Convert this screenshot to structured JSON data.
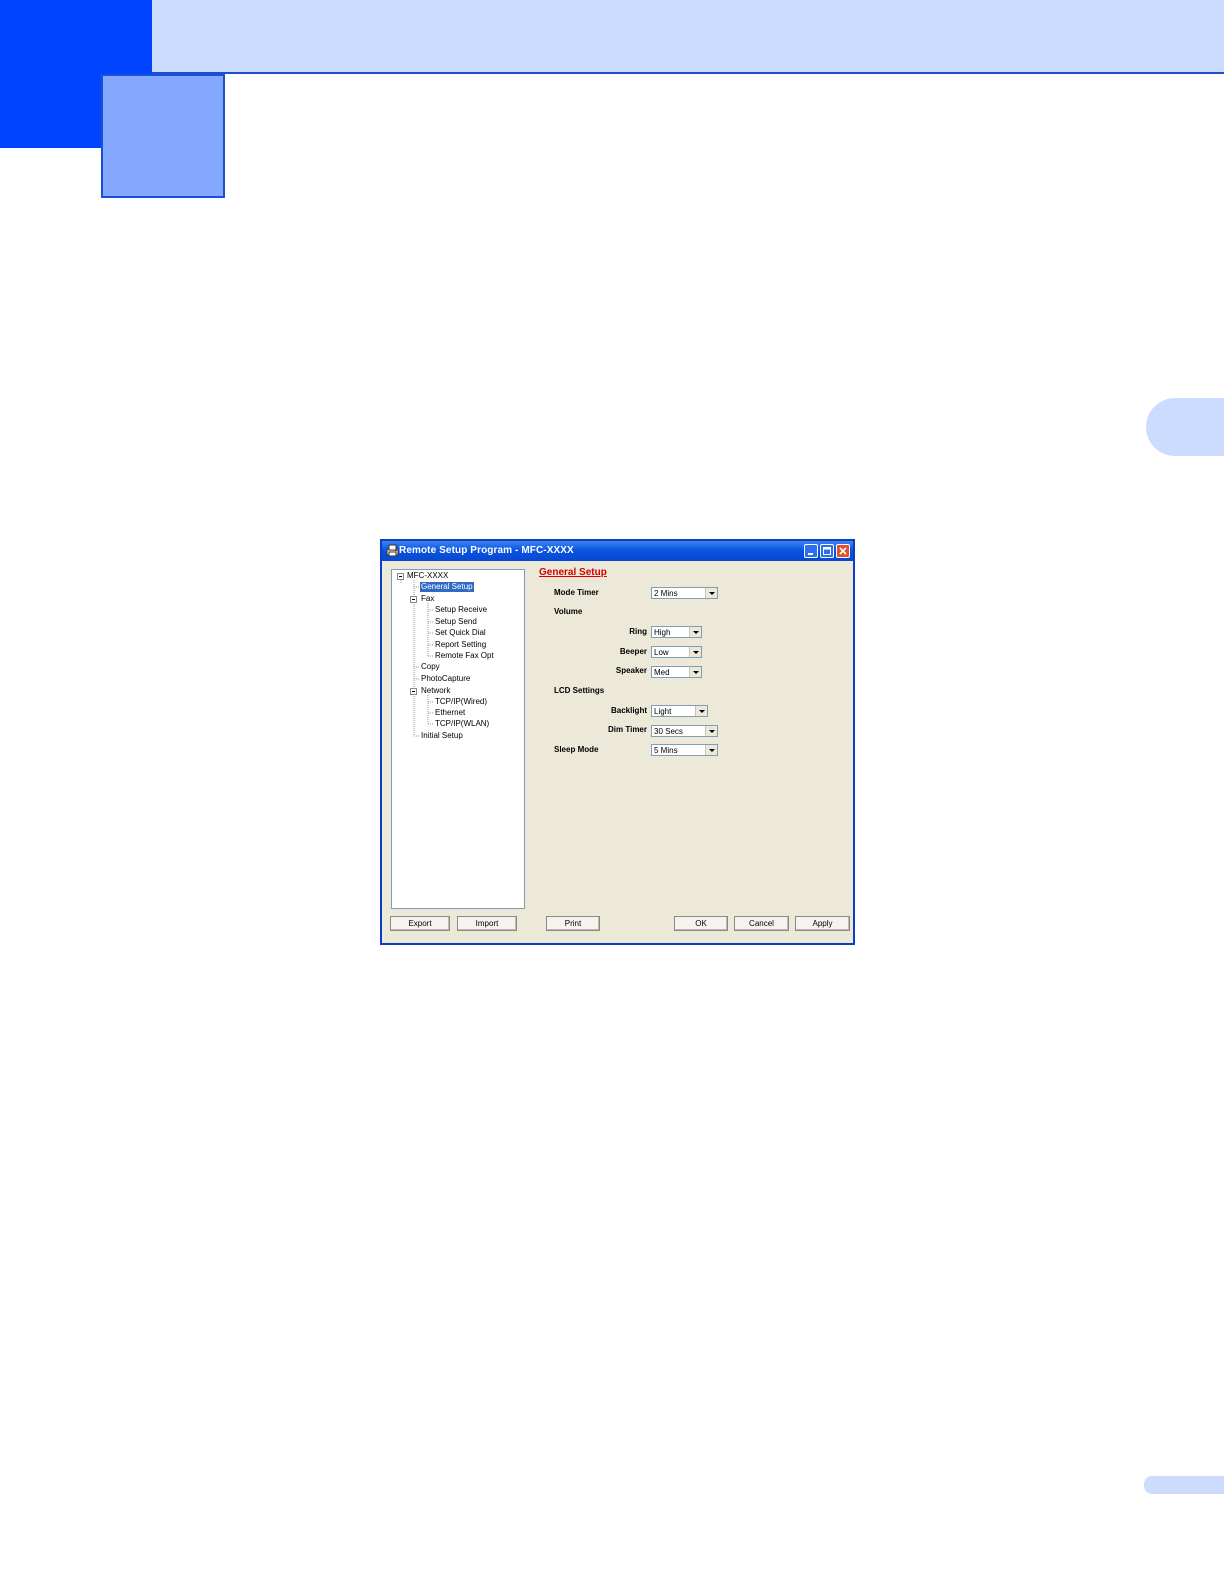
{
  "window": {
    "title": "Remote Setup Program - MFC-XXXX",
    "icons": {
      "app": "printer-app-icon",
      "minimize": "minimize-icon",
      "maximize": "maximize-icon",
      "close": "close-icon"
    }
  },
  "tree": {
    "items": [
      {
        "label": "MFC-XXXX"
      },
      {
        "label": "General Setup",
        "selected": true
      },
      {
        "label": "Fax"
      },
      {
        "label": "Setup Receive"
      },
      {
        "label": "Setup Send"
      },
      {
        "label": "Set Quick Dial"
      },
      {
        "label": "Report Setting"
      },
      {
        "label": "Remote Fax Opt"
      },
      {
        "label": "Copy"
      },
      {
        "label": "PhotoCapture"
      },
      {
        "label": "Network"
      },
      {
        "label": "TCP/IP(Wired)"
      },
      {
        "label": "Ethernet"
      },
      {
        "label": "TCP/IP(WLAN)"
      },
      {
        "label": "Initial Setup"
      }
    ]
  },
  "panel": {
    "title": "General Setup",
    "mode_timer": {
      "label": "Mode Timer",
      "value": "2 Mins"
    },
    "volume": {
      "heading": "Volume",
      "ring": {
        "label": "Ring",
        "value": "High"
      },
      "beeper": {
        "label": "Beeper",
        "value": "Low"
      },
      "speaker": {
        "label": "Speaker",
        "value": "Med"
      }
    },
    "lcd": {
      "heading": "LCD Settings",
      "backlight": {
        "label": "Backlight",
        "value": "Light"
      },
      "dim_timer": {
        "label": "Dim Timer",
        "value": "30 Secs"
      }
    },
    "sleep_mode": {
      "label": "Sleep Mode",
      "value": "5 Mins"
    }
  },
  "buttons": {
    "export": "Export",
    "import": "Import",
    "print": "Print",
    "ok": "OK",
    "cancel": "Cancel",
    "apply": "Apply"
  },
  "colors": {
    "accent_dark": "#0044ff",
    "accent_light": "#ccdcff",
    "section_title": "#d40000"
  }
}
